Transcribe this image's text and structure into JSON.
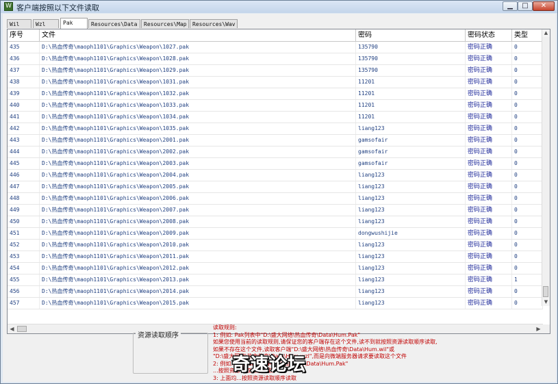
{
  "window": {
    "title": "客户端按照以下文件读取",
    "icon_glyph": "W",
    "controls": [
      "minimize-icon",
      "maximize-icon",
      "close-icon"
    ]
  },
  "tabs": [
    {
      "label": "Wil",
      "active": false
    },
    {
      "label": "Wzl",
      "active": false
    },
    {
      "label": "Pak",
      "active": true
    },
    {
      "label": "Resources\\Data",
      "active": false
    },
    {
      "label": "Resources\\Map",
      "active": false
    },
    {
      "label": "Resources\\Wav",
      "active": false
    }
  ],
  "table": {
    "headers": [
      "序号",
      "文件",
      "密码",
      "密码状态",
      "类型"
    ],
    "rows": [
      [
        "435",
        "D:\\热血传奇\\maoph1101\\Graphics\\Weapon\\1027.pak",
        "135790",
        "密码正确",
        "0"
      ],
      [
        "436",
        "D:\\热血传奇\\maoph1101\\Graphics\\Weapon\\1028.pak",
        "135790",
        "密码正确",
        "0"
      ],
      [
        "437",
        "D:\\热血传奇\\maoph1101\\Graphics\\Weapon\\1029.pak",
        "135790",
        "密码正确",
        "0"
      ],
      [
        "438",
        "D:\\热血传奇\\maoph1101\\Graphics\\Weapon\\1031.pak",
        "11201",
        "密码正确",
        "0"
      ],
      [
        "439",
        "D:\\热血传奇\\maoph1101\\Graphics\\Weapon\\1032.pak",
        "11201",
        "密码正确",
        "0"
      ],
      [
        "440",
        "D:\\热血传奇\\maoph1101\\Graphics\\Weapon\\1033.pak",
        "11201",
        "密码正确",
        "0"
      ],
      [
        "441",
        "D:\\热血传奇\\maoph1101\\Graphics\\Weapon\\1034.pak",
        "11201",
        "密码正确",
        "0"
      ],
      [
        "442",
        "D:\\热血传奇\\maoph1101\\Graphics\\Weapon\\1035.pak",
        "liang123",
        "密码正确",
        "0"
      ],
      [
        "443",
        "D:\\热血传奇\\maoph1101\\Graphics\\Weapon\\2001.pak",
        "gamsofair",
        "密码正确",
        "0"
      ],
      [
        "444",
        "D:\\热血传奇\\maoph1101\\Graphics\\Weapon\\2002.pak",
        "gamsofair",
        "密码正确",
        "0"
      ],
      [
        "445",
        "D:\\热血传奇\\maoph1101\\Graphics\\Weapon\\2003.pak",
        "gamsofair",
        "密码正确",
        "0"
      ],
      [
        "446",
        "D:\\热血传奇\\maoph1101\\Graphics\\Weapon\\2004.pak",
        "liang123",
        "密码正确",
        "0"
      ],
      [
        "447",
        "D:\\热血传奇\\maoph1101\\Graphics\\Weapon\\2005.pak",
        "liang123",
        "密码正确",
        "0"
      ],
      [
        "448",
        "D:\\热血传奇\\maoph1101\\Graphics\\Weapon\\2006.pak",
        "liang123",
        "密码正确",
        "0"
      ],
      [
        "449",
        "D:\\热血传奇\\maoph1101\\Graphics\\Weapon\\2007.pak",
        "liang123",
        "密码正确",
        "0"
      ],
      [
        "450",
        "D:\\热血传奇\\maoph1101\\Graphics\\Weapon\\2008.pak",
        "liang123",
        "密码正确",
        "0"
      ],
      [
        "451",
        "D:\\热血传奇\\maoph1101\\Graphics\\Weapon\\2009.pak",
        "dongwushijie",
        "密码正确",
        "0"
      ],
      [
        "452",
        "D:\\热血传奇\\maoph1101\\Graphics\\Weapon\\2010.pak",
        "liang123",
        "密码正确",
        "0"
      ],
      [
        "453",
        "D:\\热血传奇\\maoph1101\\Graphics\\Weapon\\2011.pak",
        "liang123",
        "密码正确",
        "0"
      ],
      [
        "454",
        "D:\\热血传奇\\maoph1101\\Graphics\\Weapon\\2012.pak",
        "liang123",
        "密码正确",
        "0"
      ],
      [
        "455",
        "D:\\热血传奇\\maoph1101\\Graphics\\Weapon\\2013.pak",
        "liang123",
        "密码正确",
        "1"
      ],
      [
        "456",
        "D:\\热血传奇\\maoph1101\\Graphics\\Weapon\\2014.pak",
        "liang123",
        "密码正确",
        "0"
      ],
      [
        "457",
        "D:\\热血传奇\\maoph1101\\Graphics\\Weapon\\2015.pak",
        "liang123",
        "密码正确",
        "0"
      ]
    ]
  },
  "resource_order": {
    "title": "资源读取顺序"
  },
  "notes": [
    "读取规则:",
    "1: 例如: Pak列表中\"D:\\盛大网络\\热血传奇\\Data\\Hum.Pak\"",
    "   如果您使用当前的读取规则,请保证您的客户端存在这个文件,读不到就按照资源读取顺序读取,",
    "   如果不存在这个文件,读取客户端\"D:\\盛大网络\\热血传奇\\Data\\Hum.wil\"或",
    "   \"D:\\盛大网络\\热血传奇\\Data\\Hum.wzl\",而是向微端服务器请求要读取这个文件",
    "2: 例如: ...在Pak列表中 \"...\\热血传奇\\Data\\Hum.Pak\"",
    "   ...按照资源读取顺序读取",
    "3: 上面均...按照资源读取顺序读取"
  ],
  "watermark": {
    "text": "奇速论坛"
  }
}
